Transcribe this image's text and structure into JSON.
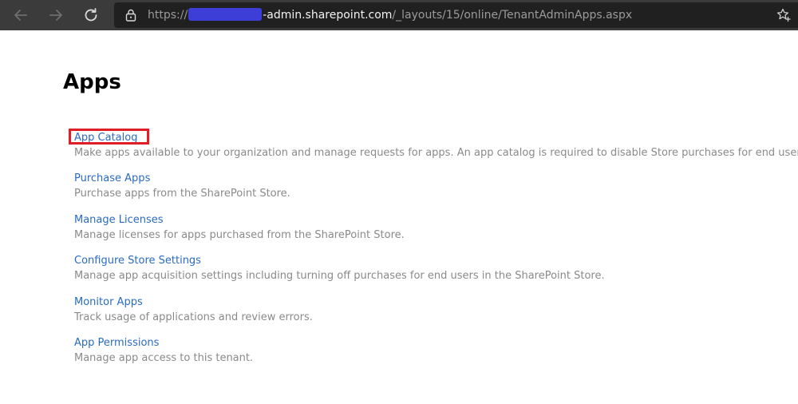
{
  "browser": {
    "icons": {
      "back": "arrow-left-icon",
      "forward": "arrow-right-icon",
      "refresh": "refresh-icon",
      "lock": "lock-icon",
      "favorites": "star-plus-icon"
    },
    "url": {
      "scheme": "https://",
      "domain": "-admin.sharepoint.com",
      "path": "/_layouts/15/online/TenantAdminApps.aspx"
    }
  },
  "page": {
    "title": "Apps",
    "items": [
      {
        "label": "App Catalog",
        "description": "Make apps available to your organization and manage requests for apps. An app catalog is required to disable Store purchases for end users."
      },
      {
        "label": "Purchase Apps",
        "description": "Purchase apps from the SharePoint Store."
      },
      {
        "label": "Manage Licenses",
        "description": "Manage licenses for apps purchased from the SharePoint Store."
      },
      {
        "label": "Configure Store Settings",
        "description": "Manage app acquisition settings including turning off purchases for end users in the SharePoint Store."
      },
      {
        "label": "Monitor Apps",
        "description": "Track usage of applications and review errors."
      },
      {
        "label": "App Permissions",
        "description": "Manage app access to this tenant."
      }
    ]
  },
  "colors": {
    "link": "#2a6bc1",
    "description": "#8a8a8a",
    "highlight": "#e01e27",
    "browser_bar": "#3b3b3b",
    "redaction": "#3d3dd8"
  }
}
